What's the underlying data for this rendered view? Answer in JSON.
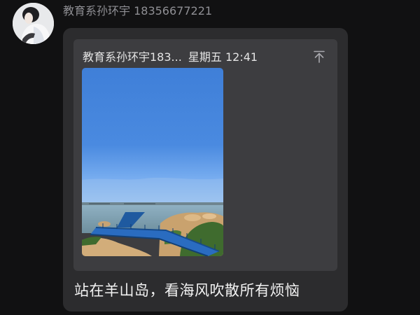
{
  "message": {
    "sender_name": "教育系孙环宇 18356677221",
    "avatar": {
      "icon": "person-icon"
    },
    "quoted": {
      "header_name": "教育系孙环宇183...",
      "header_time": "星期五 12:41",
      "pin_icon": "pin-to-top-icon",
      "image": {
        "subject": "sea-view-photo"
      }
    },
    "text": "站在羊山岛，看海风吹散所有烦恼"
  },
  "colors": {
    "background": "#111112",
    "bubble": "#2c2c2e",
    "quote_card": "#3d3d40",
    "sender_text": "#8f8f94",
    "sky": "#4a87dc"
  }
}
